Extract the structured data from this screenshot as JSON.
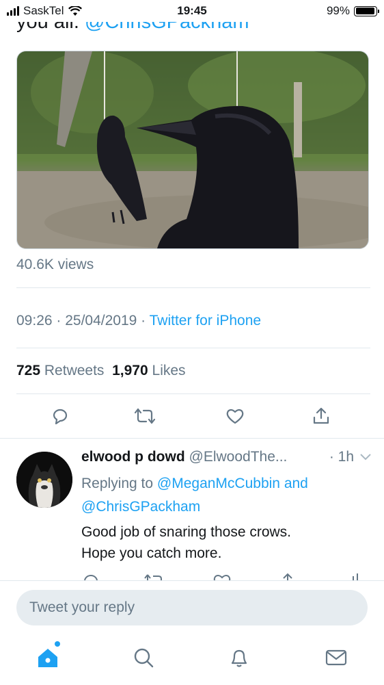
{
  "status_bar": {
    "carrier": "SaskTel",
    "time": "19:45",
    "battery": "99%"
  },
  "tweet": {
    "text_tail": "you all.",
    "mention": "@ChrisGPackham",
    "media_alt": "",
    "views": "40.6K views",
    "time": "09:26",
    "date": "25/04/2019",
    "client": "Twitter for iPhone",
    "retweets_count": "725",
    "retweets_label": "Retweets",
    "likes_count": "1,970",
    "likes_label": "Likes",
    "dot": " · "
  },
  "reply": {
    "name": "elwood p dowd",
    "handle": "@ElwoodThe...",
    "time": "· 1h",
    "replying_prefix": "Replying to",
    "replying_to_1": "@MeganMcCubbin",
    "replying_and": "and",
    "replying_to_2": "@ChrisGPackham",
    "text_line1": "Good job of snaring those crows.",
    "text_line2": "Hope you catch more."
  },
  "compose": {
    "placeholder": "Tweet your reply"
  },
  "icons": {
    "actions": [
      "reply-icon",
      "retweet-icon",
      "like-icon",
      "share-icon"
    ],
    "tabs": [
      "home-icon",
      "search-icon",
      "notifications-icon",
      "messages-icon"
    ]
  },
  "colors": {
    "accent": "#1da1f2",
    "secondary_text": "#657786",
    "primary_text": "#14171a",
    "divider": "#e1e8ed"
  }
}
